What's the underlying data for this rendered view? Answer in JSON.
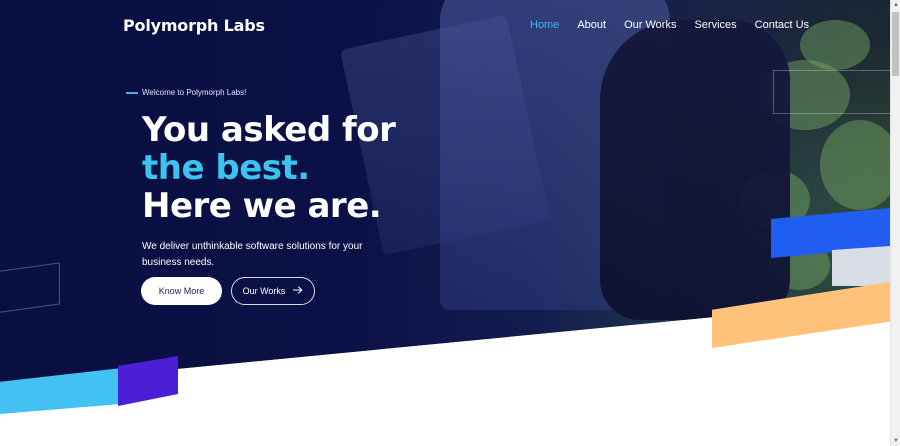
{
  "brand": "Polymorph Labs",
  "nav": {
    "items": [
      {
        "label": "Home",
        "active": true
      },
      {
        "label": "About",
        "active": false
      },
      {
        "label": "Our Works",
        "active": false
      },
      {
        "label": "Services",
        "active": false
      },
      {
        "label": "Contact Us",
        "active": false
      }
    ]
  },
  "hero": {
    "eyebrow": "Welcome to Polymorph Labs!",
    "headline_line1": "You asked for",
    "headline_line2": "the best.",
    "headline_line3": "Here we are.",
    "subtext": "We deliver unthinkable software solutions for your business needs.",
    "primary_button": "Know More",
    "secondary_button": "Our Works",
    "arrow_icon": "arrow-right-icon"
  },
  "colors": {
    "navy_background": "#0b1146",
    "accent_cyan": "#3cc3ef",
    "nav_active": "#3db7ea",
    "shape_blue": "#1f5ef0",
    "shape_orange": "#fec27a",
    "shape_cyan": "#43c1f2",
    "shape_purple": "#4a1fd6",
    "shape_gray": "#d8dde6"
  }
}
